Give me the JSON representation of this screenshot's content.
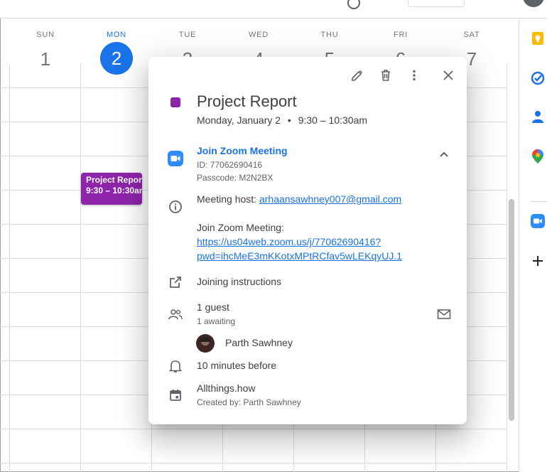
{
  "calendar": {
    "days": [
      {
        "name": "SUN",
        "num": "1"
      },
      {
        "name": "MON",
        "num": "2"
      },
      {
        "name": "TUE",
        "num": "3"
      },
      {
        "name": "WED",
        "num": "4"
      },
      {
        "name": "THU",
        "num": "5"
      },
      {
        "name": "FRI",
        "num": "6"
      },
      {
        "name": "SAT",
        "num": "7"
      }
    ],
    "event": {
      "title": "Project Report",
      "time": "9:30 – 10:30am",
      "color": "#8e24aa"
    }
  },
  "popup": {
    "title": "Project Report",
    "date": "Monday, January 2",
    "time": "9:30 – 10:30am",
    "zoom": {
      "join_label": "Join Zoom Meeting",
      "id": "ID: 77062690416",
      "passcode": "Passcode: M2N2BX"
    },
    "description": {
      "host_label": "Meeting host:",
      "host_email": "arhaansawhney007@gmail.com",
      "join_heading": "Join Zoom Meeting:",
      "url_line1": "https://us04web.zoom.us/j/77062690416?",
      "url_line2": "pwd=ihcMeE3mKKotxMPtRCfav5wLEKqyUJ.1"
    },
    "joining_instructions": "Joining instructions",
    "guests": {
      "count": "1 guest",
      "status": "1 awaiting",
      "people": [
        {
          "name": "Parth Sawhney"
        }
      ]
    },
    "reminder": "10 minutes before",
    "calendar_name": "Allthings.how",
    "created_by": "Created by: Parth Sawhney"
  },
  "colors": {
    "accent": "#1a73e8",
    "event": "#8e24aa"
  },
  "side_panel_icons": [
    "keep-icon",
    "tasks-icon",
    "contacts-icon",
    "maps-icon",
    "zoom-icon",
    "add-icon"
  ]
}
